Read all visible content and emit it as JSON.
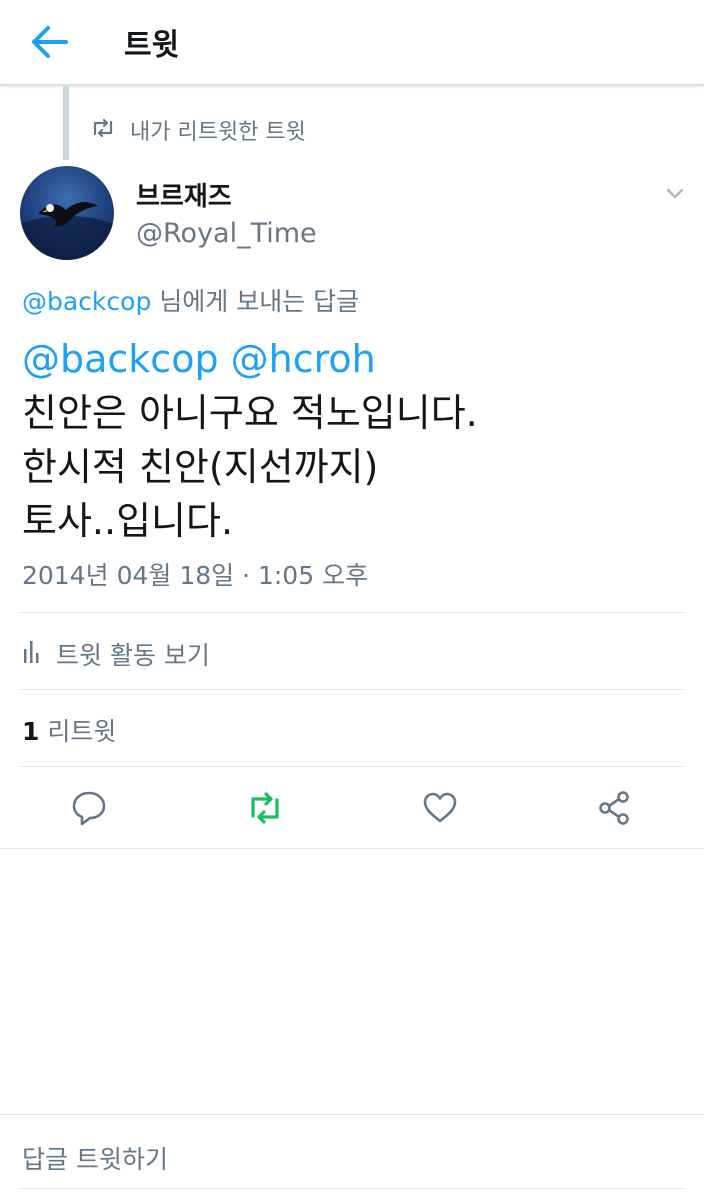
{
  "header": {
    "title": "트윗"
  },
  "retweet_context": {
    "label": "내가 리트윗한 트윗"
  },
  "tweet": {
    "author_name": "브르재즈",
    "author_handle": "@Royal_Time",
    "reply_to": {
      "mention": "@backcop",
      "suffix": " 님에게 보내는 답글"
    },
    "mentions": "@backcop @hcroh",
    "lines": [
      "친안은 아니구요 적노입니다.",
      "한시적 친안(지선까지)",
      "토사..입니다."
    ],
    "timestamp": "2014년 04월 18일 · 1:05 오후",
    "activity_label": "트윗 활동 보기",
    "retweet_count": "1",
    "retweet_label": " 리트윗"
  },
  "actions": [
    "reply-icon",
    "retweet-icon",
    "like-icon",
    "share-icon"
  ],
  "reply_box": {
    "placeholder": "답글 트윗하기"
  },
  "colors": {
    "accent": "#1da1f2",
    "retweet_active": "#17bf63",
    "secondary_text": "#657786",
    "divider": "#e1e8ed"
  }
}
